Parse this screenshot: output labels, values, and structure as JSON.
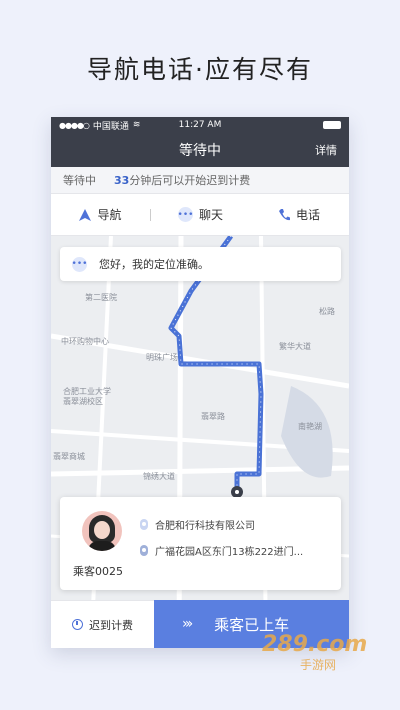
{
  "headline": "导航电话·应有尽有",
  "statusbar": {
    "carrier": "中国联通",
    "time": "11:27 AM"
  },
  "navbar": {
    "title": "等待中",
    "detail": "详情"
  },
  "infobar": {
    "status": "等待中",
    "minutes": "33",
    "message": "分钟后可以开始迟到计费"
  },
  "actions": {
    "navigate": "导航",
    "chat": "聊天",
    "phone": "电话"
  },
  "bubble": {
    "text": "您好，我的定位准确。"
  },
  "map": {
    "pois": [
      "第二医院",
      "中环购物中心",
      "明珠广场",
      "合肥工业大学",
      "翡翠湖校区",
      "翡翠商城",
      "锦绣大道",
      "繁华大道",
      "南艳湖",
      "松路",
      "翡翠路"
    ]
  },
  "passenger": {
    "name": "乘客0025",
    "start": "合肥和行科技有限公司",
    "end": "广福花园A区东门13栋222进门..."
  },
  "bottom": {
    "late_fee": "迟到计费",
    "aboard": "乘客已上车"
  },
  "watermark": {
    "text": "289.com",
    "sub": "手游网"
  },
  "colors": {
    "accent": "#5a7fe0",
    "route": "#4a72d6",
    "header": "#3b3f4a"
  }
}
